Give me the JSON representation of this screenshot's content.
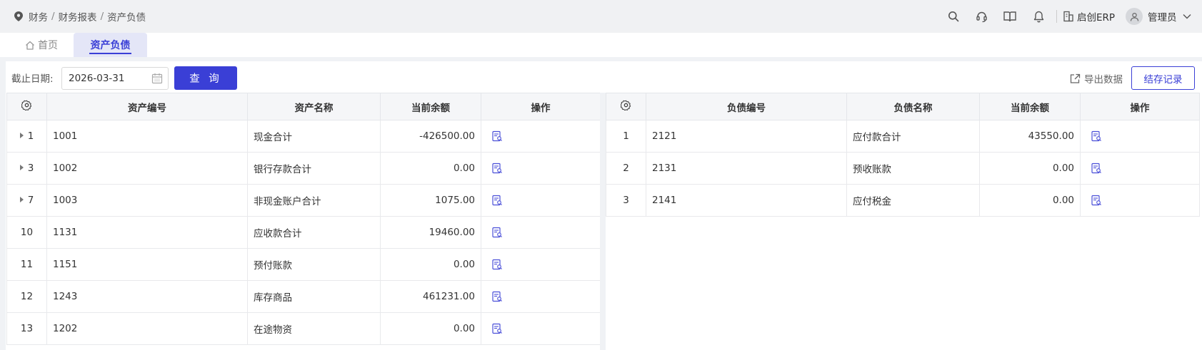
{
  "breadcrumb": [
    "财务",
    "财务报表",
    "资产负债"
  ],
  "header": {
    "company": "启创ERP",
    "user": "管理员"
  },
  "tabs": {
    "home": "首页",
    "active": "资产负债"
  },
  "toolbar": {
    "date_label": "截止日期:",
    "date_value": "2026-03-31",
    "query_label": "查 询",
    "export_label": "导出数据",
    "save_label": "结存记录"
  },
  "assets": {
    "headers": [
      "资产编号",
      "资产名称",
      "当前余额",
      "操作"
    ],
    "rows": [
      {
        "idx": "1",
        "expandable": true,
        "code": "1001",
        "name": "现金合计",
        "balance": "-426500.00"
      },
      {
        "idx": "3",
        "expandable": true,
        "code": "1002",
        "name": "银行存款合计",
        "balance": "0.00"
      },
      {
        "idx": "7",
        "expandable": true,
        "code": "1003",
        "name": "非现金账户合计",
        "balance": "1075.00"
      },
      {
        "idx": "10",
        "expandable": false,
        "code": "1131",
        "name": "应收款合计",
        "balance": "19460.00"
      },
      {
        "idx": "11",
        "expandable": false,
        "code": "1151",
        "name": "预付账款",
        "balance": "0.00"
      },
      {
        "idx": "12",
        "expandable": false,
        "code": "1243",
        "name": "库存商品",
        "balance": "461231.00"
      },
      {
        "idx": "13",
        "expandable": false,
        "code": "1202",
        "name": "在途物资",
        "balance": "0.00"
      }
    ]
  },
  "liabilities": {
    "headers": [
      "负债编号",
      "负债名称",
      "当前余额",
      "操作"
    ],
    "rows": [
      {
        "idx": "1",
        "code": "2121",
        "name": "应付款合计",
        "balance": "43550.00"
      },
      {
        "idx": "2",
        "code": "2131",
        "name": "预收账款",
        "balance": "0.00"
      },
      {
        "idx": "3",
        "code": "2141",
        "name": "应付税金",
        "balance": "0.00"
      }
    ]
  },
  "colors": {
    "primary": "#3a3fd6",
    "header_bg": "#f0f1f3",
    "tab_active_bg": "#e4e6f7"
  }
}
